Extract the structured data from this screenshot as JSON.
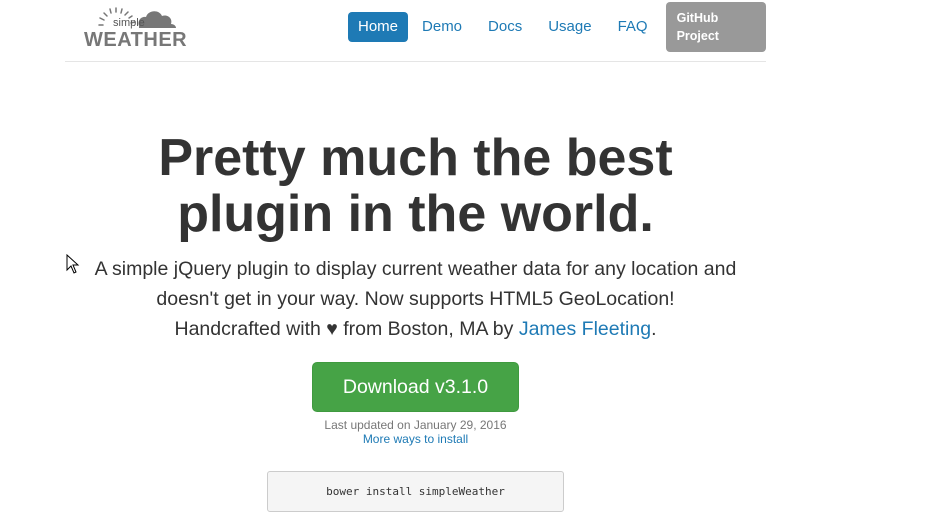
{
  "brand": {
    "logo_small": "simple",
    "logo_big": "WEATHER",
    "icon": "sun-cloud-icon"
  },
  "nav": {
    "items": [
      {
        "label": "Home",
        "active": true
      },
      {
        "label": "Demo"
      },
      {
        "label": "Docs"
      },
      {
        "label": "Usage"
      },
      {
        "label": "FAQ"
      }
    ],
    "github_label": "GitHub Project"
  },
  "hero": {
    "title_line1": "Pretty much the best",
    "title_line2": "plugin in the world.",
    "lead_line1": "A simple jQuery plugin to display current weather data for any location and",
    "lead_line2": "doesn't get in your way. Now supports HTML5 GeoLocation!",
    "lead_line3_prefix": "Handcrafted with",
    "heart": "♥",
    "lead_line3_mid": "from Boston, MA by",
    "author_link": "James Fleeting",
    "lead_line3_suffix": "."
  },
  "download": {
    "button_label": "Download v3.1.0",
    "updated": "Last updated on January 29, 2016",
    "more_link": "More ways to install"
  },
  "install": {
    "command": "bower install simpleWeather"
  },
  "colors": {
    "link": "#1e7ab5",
    "success": "#46a346",
    "muted": "#999999"
  }
}
